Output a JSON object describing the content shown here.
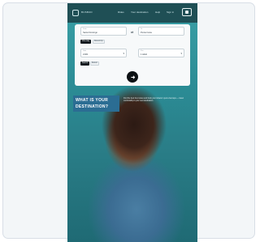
{
  "card": {},
  "topbar": {
    "logo_text": "BUSBUD",
    "nav": [
      "Rides",
      "Your destination",
      "Help",
      "Sign in"
    ]
  },
  "form": {
    "from": {
      "label": "From",
      "value": "Santo Domingo"
    },
    "to": {
      "label": "To",
      "value": "Punta Cana"
    },
    "trip_type": {
      "selected": "One-way",
      "other": "Round trip"
    },
    "date": {
      "label": "Date",
      "value": "21/01"
    },
    "passengers": {
      "label": "Pax",
      "value": "1 Adult"
    },
    "options": {
      "primary": "Search",
      "secondary": "Return"
    },
    "go_icon": "arrow-right-icon"
  },
  "hero": {
    "banner_line1": "WHAT IS YOUR",
    "banner_line2": "DESTINATION?",
    "description": "Find the best bus routes and book your tickets in just a few taps — travel comfortably to your next destination."
  },
  "colors": {
    "topbar": "#1f4f55",
    "banner": "#2b6d93",
    "accent": "#0d1114"
  }
}
